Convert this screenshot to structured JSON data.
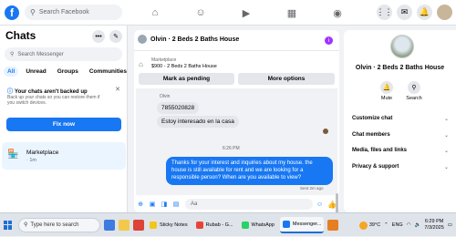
{
  "topbar": {
    "logo": "f",
    "search_placeholder": "Search Facebook",
    "nav_icons": [
      "home-icon",
      "friends-icon",
      "video-icon",
      "marketplace-icon",
      "groups-icon"
    ],
    "right_icons": [
      "menu-grid-icon",
      "messenger-icon",
      "notifications-icon",
      "profile-avatar"
    ]
  },
  "sidebar": {
    "title": "Chats",
    "search_placeholder": "Search Messenger",
    "filters": [
      "All",
      "Unread",
      "Groups",
      "Communities"
    ],
    "backup": {
      "title": "Your chats aren't backed up",
      "description": "Back up your chats so you can restore them if you switch devices.",
      "button": "Fix now"
    },
    "conversation": {
      "name": "Marketplace",
      "time": "· 1m"
    }
  },
  "conversation": {
    "title": "Olvin · 2 Beds 2 Baths House",
    "marketplace_label": "Marketplace",
    "listing": "$900 - 2 Beds 2 Baths House",
    "buttons": {
      "pending": "Mark as pending",
      "more": "More options"
    },
    "sender": "Olvin",
    "incoming": [
      "7855020828",
      "Estoy interesado en la casa"
    ],
    "timestamp": "6:26 PM",
    "outgoing": "Thanks for your interest and inquiries about my house. the house is still available for rent and we are looking for a responsible person? When are you available to view?",
    "sent_label": "Sent 2m ago",
    "composer_placeholder": "Aa"
  },
  "details": {
    "name": "Olvin · 2 Beds 2 Baths House",
    "actions": {
      "mute": "Mute",
      "search": "Search"
    },
    "sections": [
      "Customize chat",
      "Chat members",
      "Media, files and links",
      "Privacy & support"
    ]
  },
  "taskbar": {
    "search_placeholder": "Type here to search",
    "apps": [
      {
        "label": "Sticky Notes",
        "color": "#f5c518"
      },
      {
        "label": "Rubab - G...",
        "color": "#e94235"
      },
      {
        "label": "WhatsApp",
        "color": "#25d366"
      },
      {
        "label": "Messenger...",
        "color": "#1877f2"
      }
    ],
    "temperature": "39°C",
    "language": "ENG",
    "time": "6:29 PM",
    "date": "7/3/2025"
  }
}
